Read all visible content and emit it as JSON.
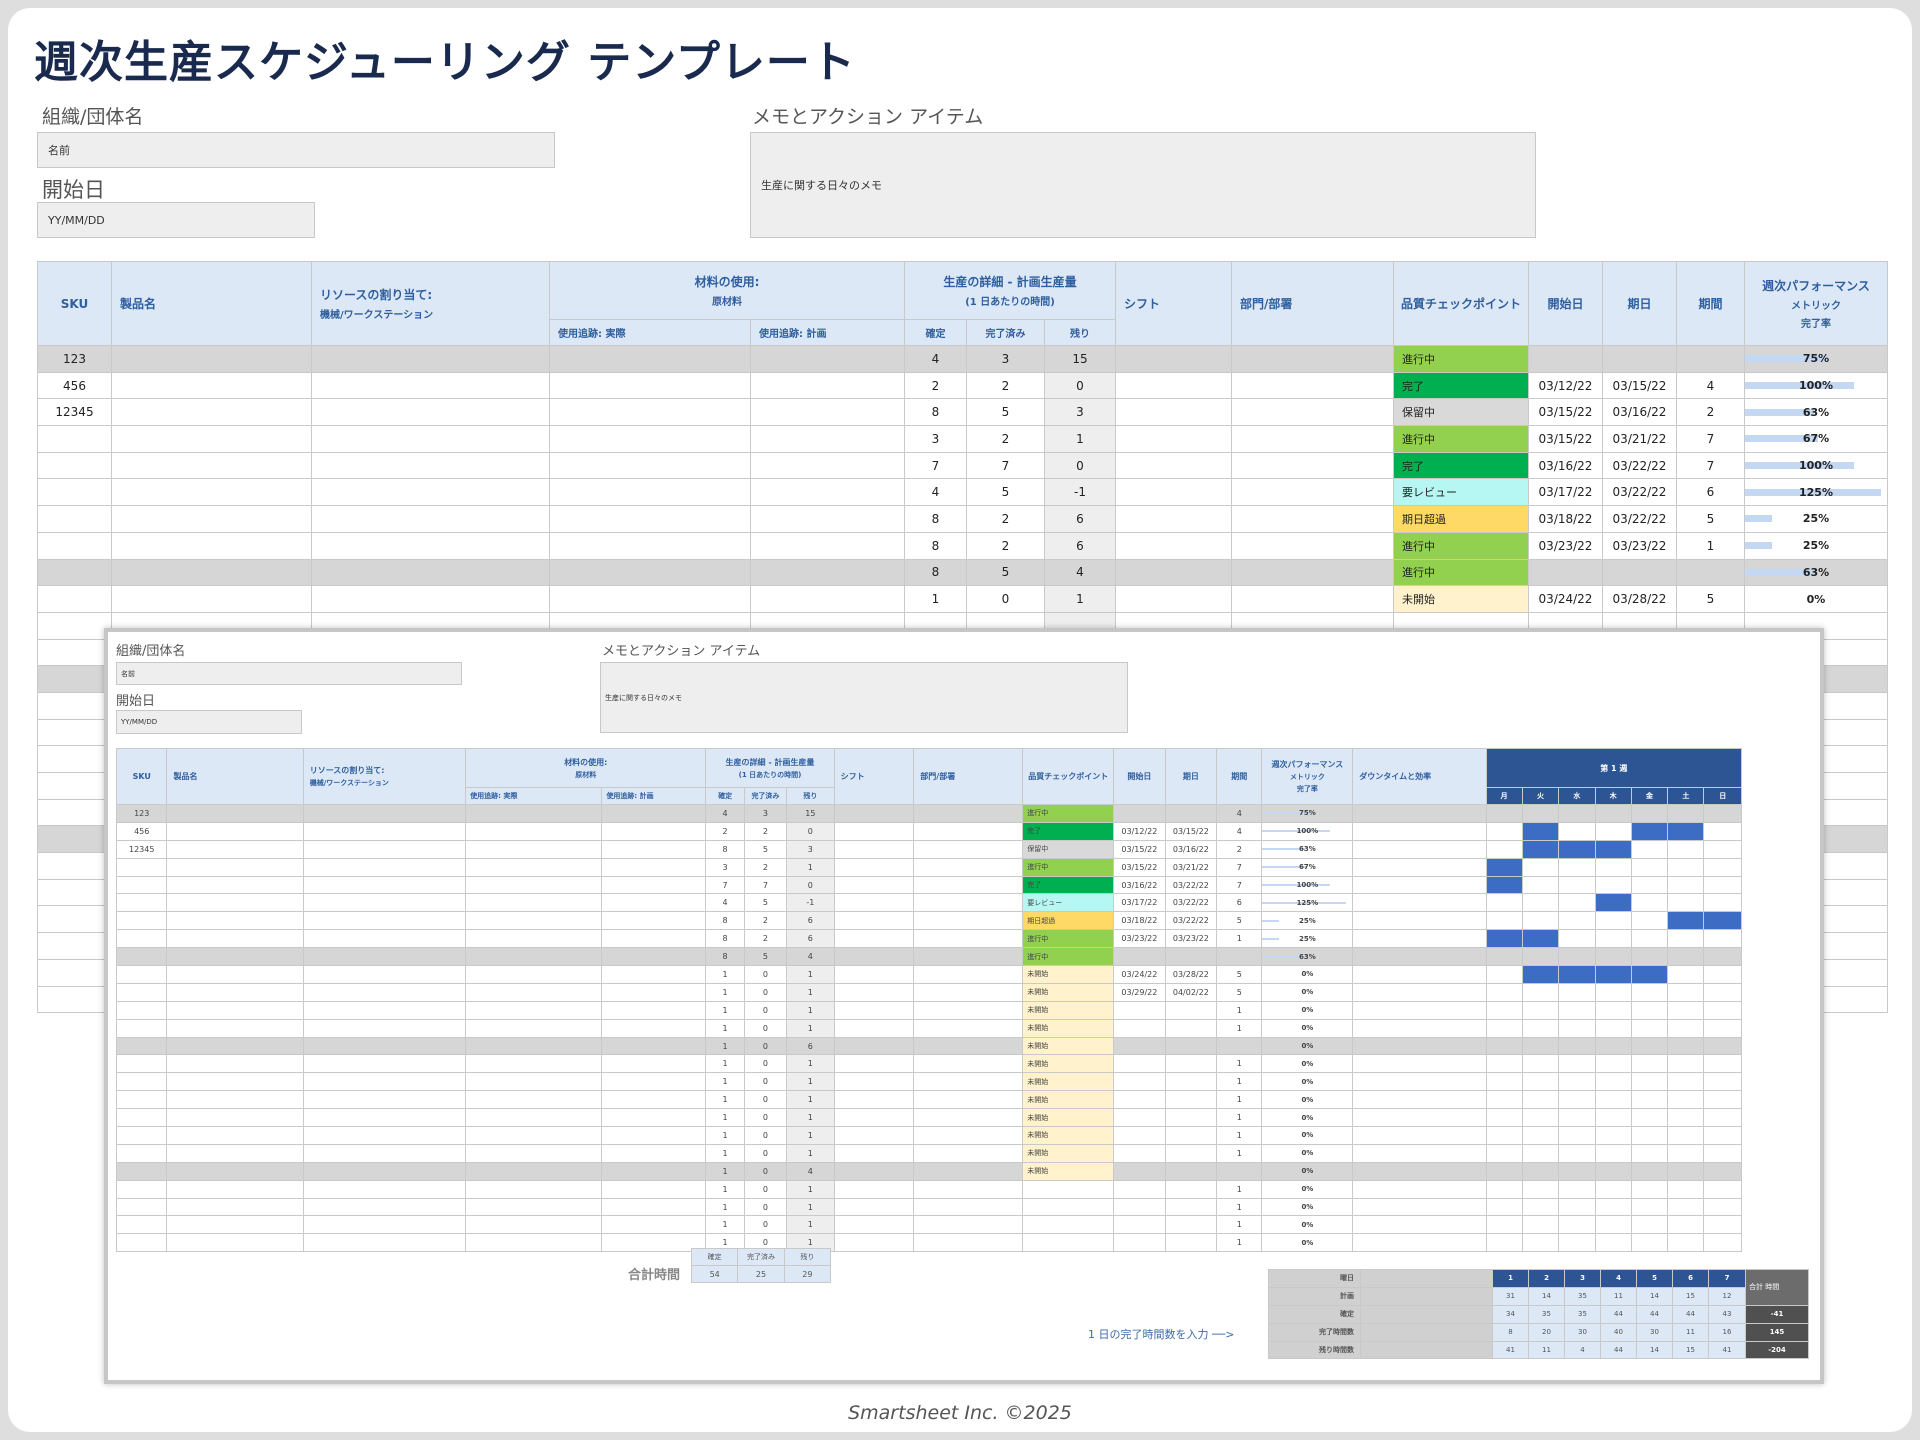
{
  "title": "週次生産スケジューリング テンプレート",
  "org": {
    "label": "組織/団体名",
    "value": "名前"
  },
  "start": {
    "label": "開始日",
    "value": "YY/MM/DD"
  },
  "notes": {
    "label": "メモとアクション アイテム",
    "value": "生産に関する日々のメモ"
  },
  "headers": {
    "sku": "SKU",
    "product": "製品名",
    "resource": "リソースの割り当て:",
    "resource_sub": "機械/ワークステーション",
    "material": "材料の使用:",
    "material_sub": "原材料",
    "usage_actual": "使用追跡: 実際",
    "usage_plan": "使用追跡: 計画",
    "prod": "生産の詳細 - 計画生産量",
    "prod_sub": "(1 日あたりの時間)",
    "confirmed": "確定",
    "done": "完了済み",
    "remaining": "残り",
    "shift": "シフト",
    "dept": "部門/部署",
    "qc": "品質チェックポイント",
    "start_date": "開始日",
    "due_date": "期日",
    "duration": "期間",
    "perf": "週次パフォーマンス",
    "perf_metric": "メトリック",
    "perf_sub": "完了率",
    "downtime": "ダウンタイムと効率",
    "week": "第 1 週",
    "days": [
      "月",
      "火",
      "水",
      "木",
      "金",
      "土",
      "日"
    ]
  },
  "main_rows": [
    {
      "sku": "123",
      "c": "4",
      "d": "3",
      "r": "15",
      "status": "進行中",
      "color": "#92d050",
      "start": "",
      "due": "",
      "dur": "",
      "pct": "75%",
      "p": 0.75,
      "grey": true
    },
    {
      "sku": "456",
      "c": "2",
      "d": "2",
      "r": "0",
      "status": "完了",
      "color": "#00b050",
      "start": "03/12/22",
      "due": "03/15/22",
      "dur": "4",
      "pct": "100%",
      "p": 1.0,
      "grey": false
    },
    {
      "sku": "12345",
      "c": "8",
      "d": "5",
      "r": "3",
      "status": "保留中",
      "color": "#d9d9d9",
      "start": "03/15/22",
      "due": "03/16/22",
      "dur": "2",
      "pct": "63%",
      "p": 0.63,
      "grey": false
    },
    {
      "sku": "",
      "c": "3",
      "d": "2",
      "r": "1",
      "status": "進行中",
      "color": "#92d050",
      "start": "03/15/22",
      "due": "03/21/22",
      "dur": "7",
      "pct": "67%",
      "p": 0.67,
      "grey": false
    },
    {
      "sku": "",
      "c": "7",
      "d": "7",
      "r": "0",
      "status": "完了",
      "color": "#00b050",
      "start": "03/16/22",
      "due": "03/22/22",
      "dur": "7",
      "pct": "100%",
      "p": 1.0,
      "grey": false
    },
    {
      "sku": "",
      "c": "4",
      "d": "5",
      "r": "-1",
      "status": "要レビュー",
      "color": "#b7f7f3",
      "start": "03/17/22",
      "due": "03/22/22",
      "dur": "6",
      "pct": "125%",
      "p": 1.25,
      "grey": false
    },
    {
      "sku": "",
      "c": "8",
      "d": "2",
      "r": "6",
      "status": "期日超過",
      "color": "#ffd966",
      "start": "03/18/22",
      "due": "03/22/22",
      "dur": "5",
      "pct": "25%",
      "p": 0.25,
      "grey": false
    },
    {
      "sku": "",
      "c": "8",
      "d": "2",
      "r": "6",
      "status": "進行中",
      "color": "#92d050",
      "start": "03/23/22",
      "due": "03/23/22",
      "dur": "1",
      "pct": "25%",
      "p": 0.25,
      "grey": false
    },
    {
      "sku": "",
      "c": "8",
      "d": "5",
      "r": "4",
      "status": "進行中",
      "color": "#92d050",
      "start": "",
      "due": "",
      "dur": "",
      "pct": "63%",
      "p": 0.63,
      "grey": true
    },
    {
      "sku": "",
      "c": "1",
      "d": "0",
      "r": "1",
      "status": "未開始",
      "color": "#fff2cc",
      "start": "03/24/22",
      "due": "03/28/22",
      "dur": "5",
      "pct": "0%",
      "p": 0,
      "grey": false
    }
  ],
  "overlay_rows": [
    {
      "sku": "123",
      "c": "4",
      "d": "3",
      "r": "15",
      "status": "進行中",
      "color": "#92d050",
      "start": "",
      "due": "",
      "dur": "4",
      "pct": "75%",
      "p": 0.75,
      "grey": true,
      "g": []
    },
    {
      "sku": "456",
      "c": "2",
      "d": "2",
      "r": "0",
      "status": "完了",
      "color": "#00b050",
      "start": "03/12/22",
      "due": "03/15/22",
      "dur": "4",
      "pct": "100%",
      "p": 1.0,
      "grey": false,
      "g": [
        1,
        4,
        5
      ]
    },
    {
      "sku": "12345",
      "c": "8",
      "d": "5",
      "r": "3",
      "status": "保留中",
      "color": "#d9d9d9",
      "start": "03/15/22",
      "due": "03/16/22",
      "dur": "2",
      "pct": "63%",
      "p": 0.63,
      "grey": false,
      "g": [
        1,
        2,
        3
      ]
    },
    {
      "sku": "",
      "c": "3",
      "d": "2",
      "r": "1",
      "status": "進行中",
      "color": "#92d050",
      "start": "03/15/22",
      "due": "03/21/22",
      "dur": "7",
      "pct": "67%",
      "p": 0.67,
      "grey": false,
      "g": [
        0
      ]
    },
    {
      "sku": "",
      "c": "7",
      "d": "7",
      "r": "0",
      "status": "完了",
      "color": "#00b050",
      "start": "03/16/22",
      "due": "03/22/22",
      "dur": "7",
      "pct": "100%",
      "p": 1.0,
      "grey": false,
      "g": [
        0
      ]
    },
    {
      "sku": "",
      "c": "4",
      "d": "5",
      "r": "-1",
      "status": "要レビュー",
      "color": "#b7f7f3",
      "start": "03/17/22",
      "due": "03/22/22",
      "dur": "6",
      "pct": "125%",
      "p": 1.25,
      "grey": false,
      "g": [
        3
      ]
    },
    {
      "sku": "",
      "c": "8",
      "d": "2",
      "r": "6",
      "status": "期日超過",
      "color": "#ffd966",
      "start": "03/18/22",
      "due": "03/22/22",
      "dur": "5",
      "pct": "25%",
      "p": 0.25,
      "grey": false,
      "g": [
        5,
        6
      ]
    },
    {
      "sku": "",
      "c": "8",
      "d": "2",
      "r": "6",
      "status": "進行中",
      "color": "#92d050",
      "start": "03/23/22",
      "due": "03/23/22",
      "dur": "1",
      "pct": "25%",
      "p": 0.25,
      "grey": false,
      "g": [
        0,
        1
      ]
    },
    {
      "sku": "",
      "c": "8",
      "d": "5",
      "r": "4",
      "status": "進行中",
      "color": "#92d050",
      "start": "",
      "due": "",
      "dur": "",
      "pct": "63%",
      "p": 0.63,
      "grey": true,
      "g": []
    },
    {
      "sku": "",
      "c": "1",
      "d": "0",
      "r": "1",
      "status": "未開始",
      "color": "#fff2cc",
      "start": "03/24/22",
      "due": "03/28/22",
      "dur": "5",
      "pct": "0%",
      "p": 0,
      "grey": false,
      "g": [
        1,
        2,
        3,
        4
      ]
    },
    {
      "sku": "",
      "c": "1",
      "d": "0",
      "r": "1",
      "status": "未開始",
      "color": "#fff2cc",
      "start": "03/29/22",
      "due": "04/02/22",
      "dur": "5",
      "pct": "0%",
      "p": 0,
      "grey": false,
      "g": []
    },
    {
      "sku": "",
      "c": "1",
      "d": "0",
      "r": "1",
      "status": "未開始",
      "color": "#fff2cc",
      "start": "",
      "due": "",
      "dur": "1",
      "pct": "0%",
      "p": 0,
      "grey": false,
      "g": []
    },
    {
      "sku": "",
      "c": "1",
      "d": "0",
      "r": "1",
      "status": "未開始",
      "color": "#fff2cc",
      "start": "",
      "due": "",
      "dur": "1",
      "pct": "0%",
      "p": 0,
      "grey": false,
      "g": []
    },
    {
      "sku": "",
      "c": "1",
      "d": "0",
      "r": "6",
      "status": "未開始",
      "color": "#fff2cc",
      "start": "",
      "due": "",
      "dur": "",
      "pct": "0%",
      "p": 0,
      "grey": true,
      "g": []
    },
    {
      "sku": "",
      "c": "1",
      "d": "0",
      "r": "1",
      "status": "未開始",
      "color": "#fff2cc",
      "start": "",
      "due": "",
      "dur": "1",
      "pct": "0%",
      "p": 0,
      "grey": false,
      "g": []
    },
    {
      "sku": "",
      "c": "1",
      "d": "0",
      "r": "1",
      "status": "未開始",
      "color": "#fff2cc",
      "start": "",
      "due": "",
      "dur": "1",
      "pct": "0%",
      "p": 0,
      "grey": false,
      "g": []
    },
    {
      "sku": "",
      "c": "1",
      "d": "0",
      "r": "1",
      "status": "未開始",
      "color": "#fff2cc",
      "start": "",
      "due": "",
      "dur": "1",
      "pct": "0%",
      "p": 0,
      "grey": false,
      "g": []
    },
    {
      "sku": "",
      "c": "1",
      "d": "0",
      "r": "1",
      "status": "未開始",
      "color": "#fff2cc",
      "start": "",
      "due": "",
      "dur": "1",
      "pct": "0%",
      "p": 0,
      "grey": false,
      "g": []
    },
    {
      "sku": "",
      "c": "1",
      "d": "0",
      "r": "1",
      "status": "未開始",
      "color": "#fff2cc",
      "start": "",
      "due": "",
      "dur": "1",
      "pct": "0%",
      "p": 0,
      "grey": false,
      "g": []
    },
    {
      "sku": "",
      "c": "1",
      "d": "0",
      "r": "1",
      "status": "未開始",
      "color": "#fff2cc",
      "start": "",
      "due": "",
      "dur": "1",
      "pct": "0%",
      "p": 0,
      "grey": false,
      "g": []
    },
    {
      "sku": "",
      "c": "1",
      "d": "0",
      "r": "4",
      "status": "未開始",
      "color": "#fff2cc",
      "start": "",
      "due": "",
      "dur": "",
      "pct": "0%",
      "p": 0,
      "grey": true,
      "g": []
    },
    {
      "sku": "",
      "c": "1",
      "d": "0",
      "r": "1",
      "status": "",
      "color": "",
      "start": "",
      "due": "",
      "dur": "1",
      "pct": "0%",
      "p": 0,
      "grey": false,
      "g": []
    },
    {
      "sku": "",
      "c": "1",
      "d": "0",
      "r": "1",
      "status": "",
      "color": "",
      "start": "",
      "due": "",
      "dur": "1",
      "pct": "0%",
      "p": 0,
      "grey": false,
      "g": []
    },
    {
      "sku": "",
      "c": "1",
      "d": "0",
      "r": "1",
      "status": "",
      "color": "",
      "start": "",
      "due": "",
      "dur": "1",
      "pct": "0%",
      "p": 0,
      "grey": false,
      "g": []
    },
    {
      "sku": "",
      "c": "1",
      "d": "0",
      "r": "1",
      "status": "",
      "color": "",
      "start": "",
      "due": "",
      "dur": "1",
      "pct": "0%",
      "p": 0,
      "grey": false,
      "g": []
    }
  ],
  "totals": {
    "label": "合計時間",
    "headers": [
      "確定",
      "完了済み",
      "残り"
    ],
    "values": [
      "54",
      "25",
      "29"
    ]
  },
  "summary": {
    "rows": [
      "曜日",
      "計画",
      "確定",
      "完了時間数",
      "残り時間数"
    ],
    "days": [
      "1",
      "2",
      "3",
      "4",
      "5",
      "6",
      "7"
    ],
    "plan": [
      "31",
      "14",
      "35",
      "11",
      "14",
      "15",
      "12"
    ],
    "confirmed": [
      "34",
      "35",
      "35",
      "44",
      "44",
      "44",
      "43"
    ],
    "completed": [
      "8",
      "20",
      "30",
      "40",
      "30",
      "11",
      "16"
    ],
    "remaining": [
      "41",
      "11",
      "4",
      "44",
      "14",
      "15",
      "41"
    ],
    "total_header": "合計 時間",
    "total_values": [
      "-41",
      "145",
      "-204"
    ],
    "hint": "1 日の完了時間数を入力 ──>"
  },
  "footer": "Smartsheet Inc. ©2025"
}
